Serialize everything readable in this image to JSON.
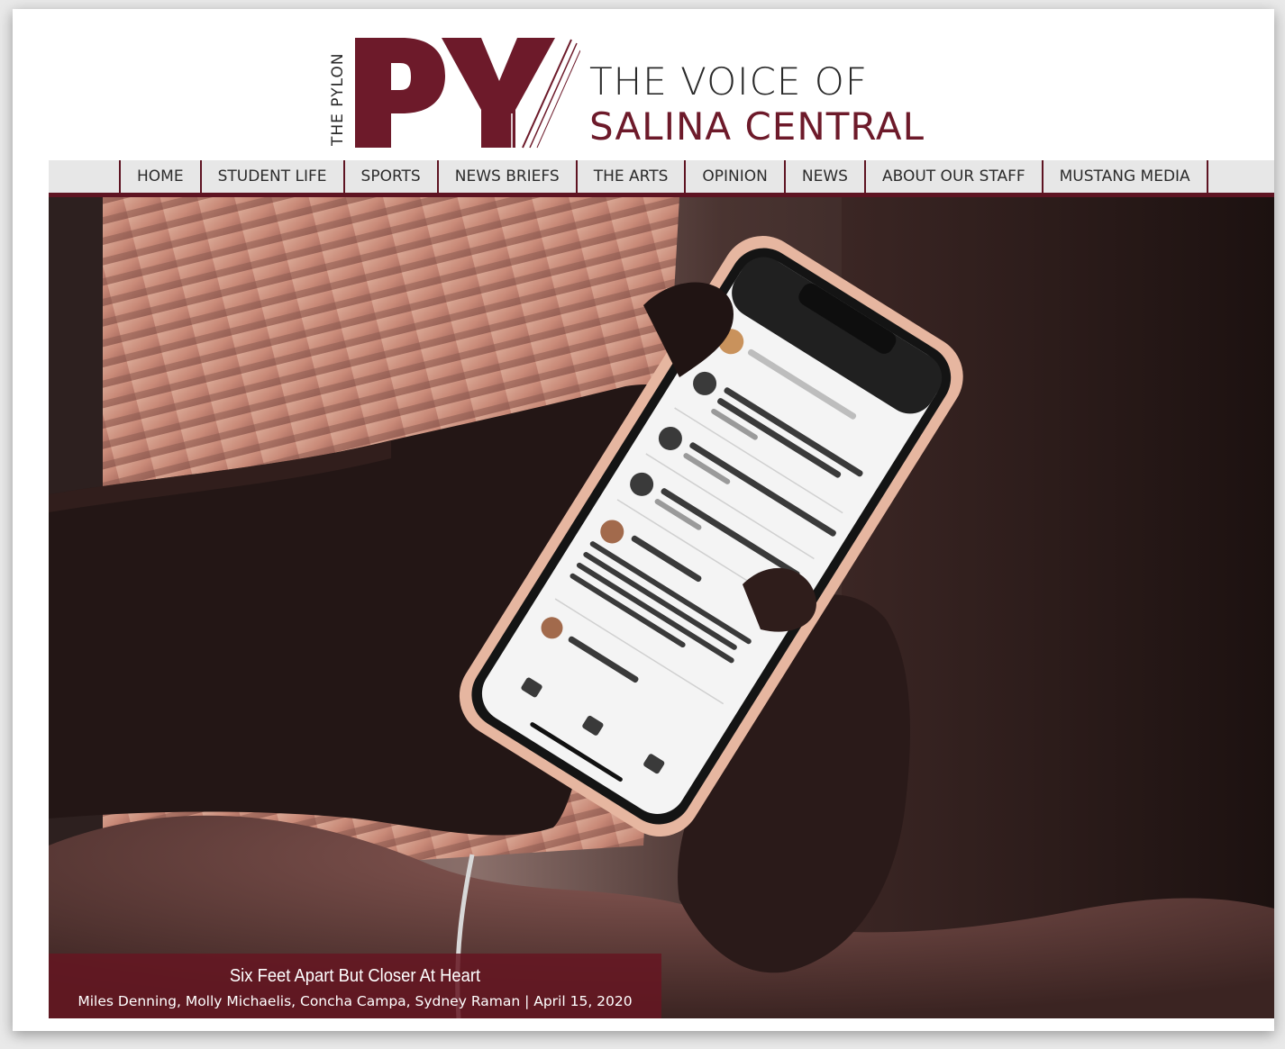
{
  "brand": {
    "vertical_text": "THE PYLON",
    "mark": "PY",
    "tagline_line1": "THE VOICE OF",
    "tagline_line2": "SALINA CENTRAL",
    "colors": {
      "maroon": "#6d1a2a",
      "nav_bar": "#e7e7e7",
      "nav_accent": "#5e1422"
    }
  },
  "nav": {
    "items": [
      {
        "label": "HOME"
      },
      {
        "label": "STUDENT LIFE"
      },
      {
        "label": "SPORTS"
      },
      {
        "label": "NEWS BRIEFS"
      },
      {
        "label": "THE ARTS"
      },
      {
        "label": "OPINION"
      },
      {
        "label": "NEWS"
      },
      {
        "label": "ABOUT OUR STAFF"
      },
      {
        "label": "MUSTANG MEDIA"
      }
    ]
  },
  "featured": {
    "title": "Six Feet Apart But Closer At Heart",
    "byline": "Miles Denning, Molly Michaelis, Concha Campa, Sydney Raman | April 15, 2020",
    "photo_icon": "photo-phone-classroom-app"
  }
}
